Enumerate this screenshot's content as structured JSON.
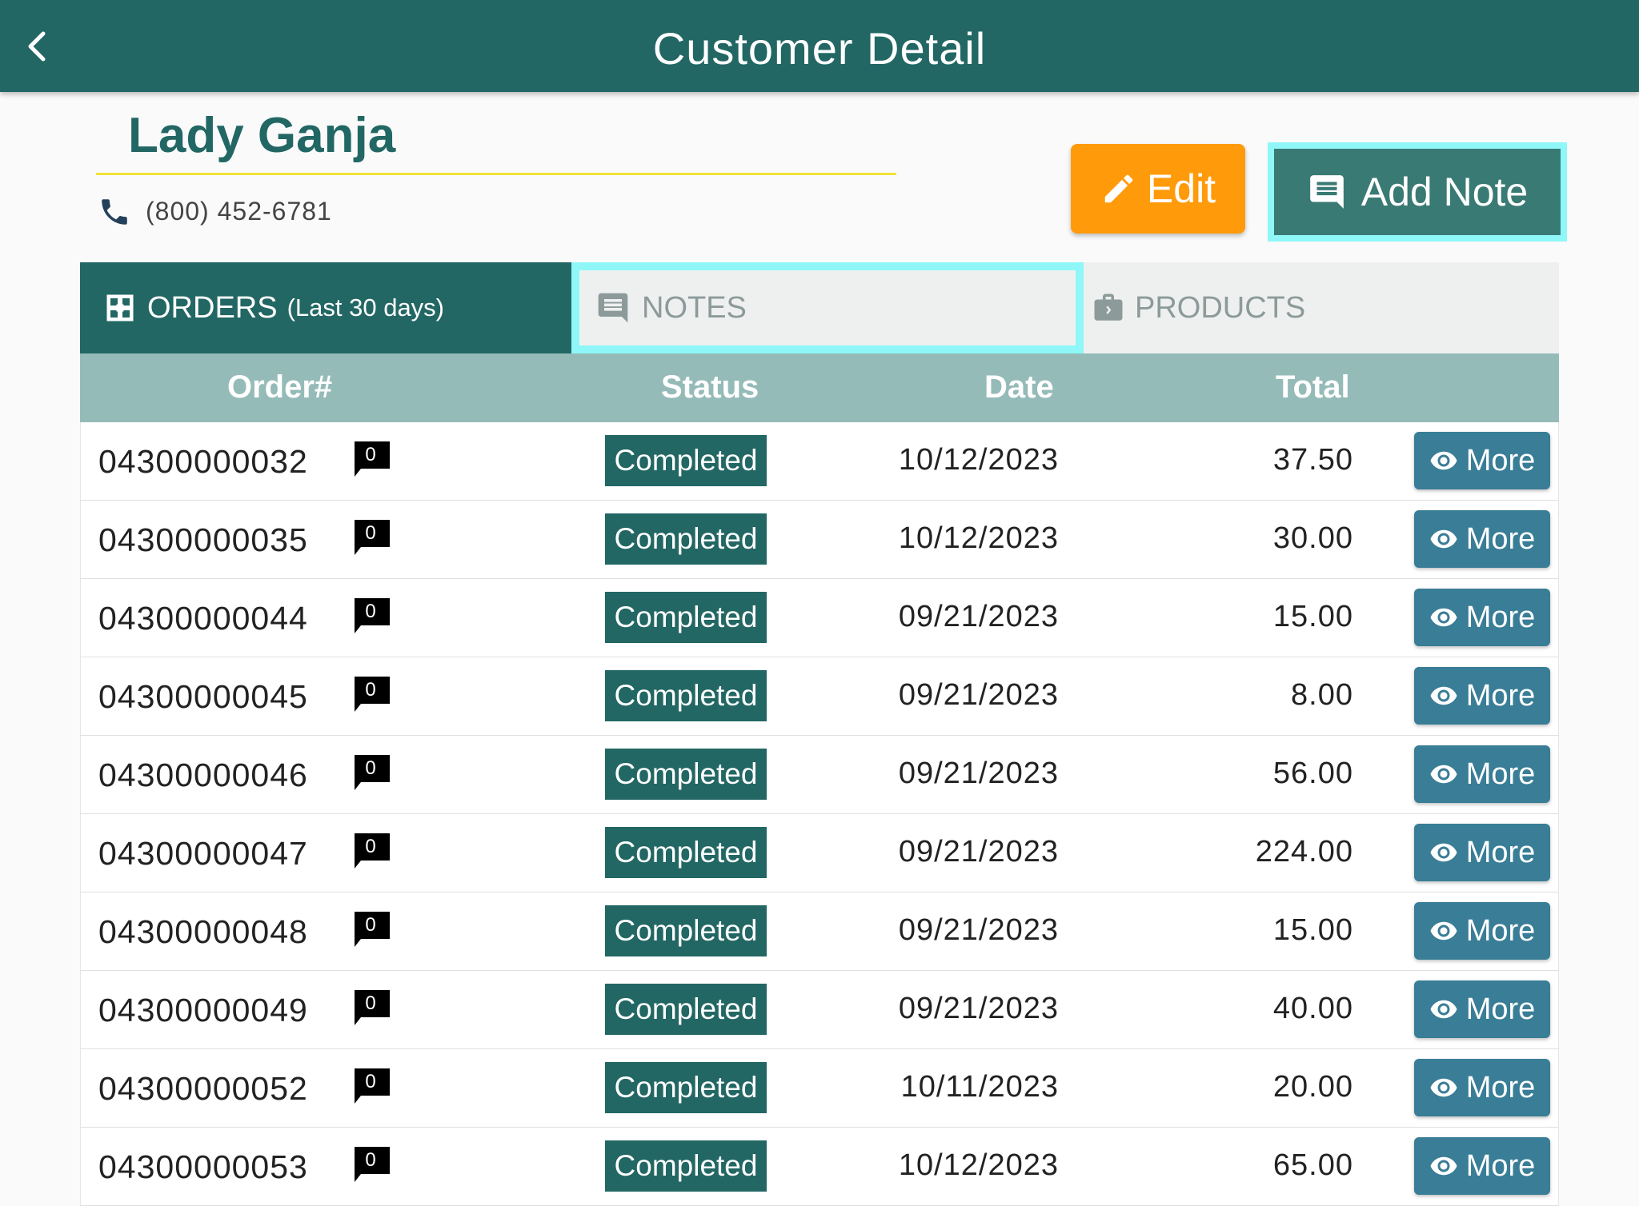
{
  "appbar": {
    "title": "Customer Detail"
  },
  "customer": {
    "name": "Lady Ganja",
    "phone": "(800) 452-6781"
  },
  "actions": {
    "edit_label": "Edit",
    "add_note_label": "Add Note"
  },
  "tabs": {
    "orders_label": "ORDERS",
    "orders_sub": "(Last 30 days)",
    "notes_label": "NOTES",
    "products_label": "PRODUCTS"
  },
  "table": {
    "headers": {
      "order": "Order#",
      "status": "Status",
      "date": "Date",
      "total": "Total"
    },
    "more_label": "More",
    "rows": [
      {
        "order": "04300000032",
        "notes": "0",
        "status": "Completed",
        "date": "10/12/2023",
        "total": "37.50"
      },
      {
        "order": "04300000035",
        "notes": "0",
        "status": "Completed",
        "date": "10/12/2023",
        "total": "30.00"
      },
      {
        "order": "04300000044",
        "notes": "0",
        "status": "Completed",
        "date": "09/21/2023",
        "total": "15.00"
      },
      {
        "order": "04300000045",
        "notes": "0",
        "status": "Completed",
        "date": "09/21/2023",
        "total": "8.00"
      },
      {
        "order": "04300000046",
        "notes": "0",
        "status": "Completed",
        "date": "09/21/2023",
        "total": "56.00"
      },
      {
        "order": "04300000047",
        "notes": "0",
        "status": "Completed",
        "date": "09/21/2023",
        "total": "224.00"
      },
      {
        "order": "04300000048",
        "notes": "0",
        "status": "Completed",
        "date": "09/21/2023",
        "total": "15.00"
      },
      {
        "order": "04300000049",
        "notes": "0",
        "status": "Completed",
        "date": "09/21/2023",
        "total": "40.00"
      },
      {
        "order": "04300000052",
        "notes": "0",
        "status": "Completed",
        "date": "10/11/2023",
        "total": "20.00"
      },
      {
        "order": "04300000053",
        "notes": "0",
        "status": "Completed",
        "date": "10/12/2023",
        "total": "65.00"
      }
    ]
  },
  "colors": {
    "primary": "#226764",
    "edit": "#ff9a0a",
    "add_note": "#3a7a74",
    "highlight": "#8ff7f7",
    "header_row": "#95bbb8",
    "more_button": "#397d96",
    "name_underline": "#f2e33c"
  },
  "icons": {
    "back": "chevron-left-icon",
    "phone": "phone-icon",
    "edit": "pencil-icon",
    "add_note": "comment-icon",
    "orders": "orders-icon",
    "notes": "comment-icon",
    "products": "briefcase-icon",
    "note_badge": "speech-bubble-icon",
    "more": "eye-icon"
  }
}
